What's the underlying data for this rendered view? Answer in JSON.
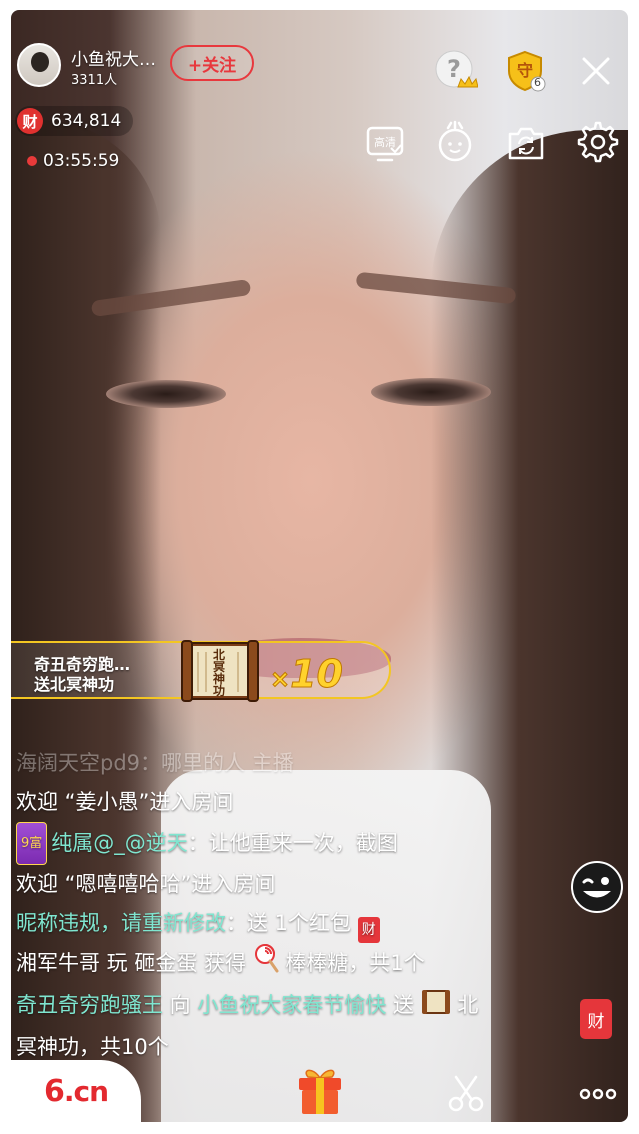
{
  "header": {
    "streamer_name": "小鱼祝大…",
    "viewer_count": "3311人",
    "follow_label": "+关注",
    "fortune_badge": "财",
    "fortune_value": "634,814",
    "live_time": "03:55:59",
    "guard_level": "6"
  },
  "toolbar": {
    "hd_label": "高清"
  },
  "gift_banner": {
    "sender": "奇丑奇穷跑…",
    "text": "送北冥神功",
    "book_label": "北冥神功",
    "multiplier_x": "×",
    "multiplier_value": "10"
  },
  "chat": {
    "line0": "海阔天空pd9：哪里的人 主播",
    "line1": "欢迎 “姜小愚”进入房间",
    "line2_badge": "9富",
    "line2_user": "纯属@_@逆天",
    "line2_text": "：让他重来一次，截图",
    "line3": "欢迎 “嗯嘻嘻哈哈”进入房间",
    "line4_teal": "昵称违规，请重新修改",
    "line4_text": "：送 1个红包",
    "line4_icon": "财",
    "line5_a": "湘军牛哥 玩 砸金蛋 获得 ",
    "line5_b": " 棒棒糖，共1个",
    "line6_user": "奇丑奇穷跑骚王",
    "line6_mid": " 向 ",
    "line6_target": "小鱼祝大家春节愉快",
    "line6_send": " 送 ",
    "line6_gift": " 北",
    "line7": "冥神功，共10个"
  },
  "side": {
    "fortune_label": "财"
  },
  "bottom": {
    "logo_main": "6",
    "logo_cn": ".cn"
  },
  "colors": {
    "accent_red": "#e3292f",
    "follow_red": "#e8383d",
    "chat_teal": "#7fe6d0",
    "gift_gold": "#ffd22c"
  },
  "icons": [
    "help-crown-icon",
    "guard-shield-icon",
    "close-icon",
    "hd-quality-icon",
    "face-beauty-icon",
    "camera-switch-icon",
    "settings-gear-icon",
    "emoji-wink-icon",
    "gift-box-icon",
    "scissors-icon",
    "more-dots-icon",
    "book-gift-icon",
    "lollipop-icon"
  ]
}
